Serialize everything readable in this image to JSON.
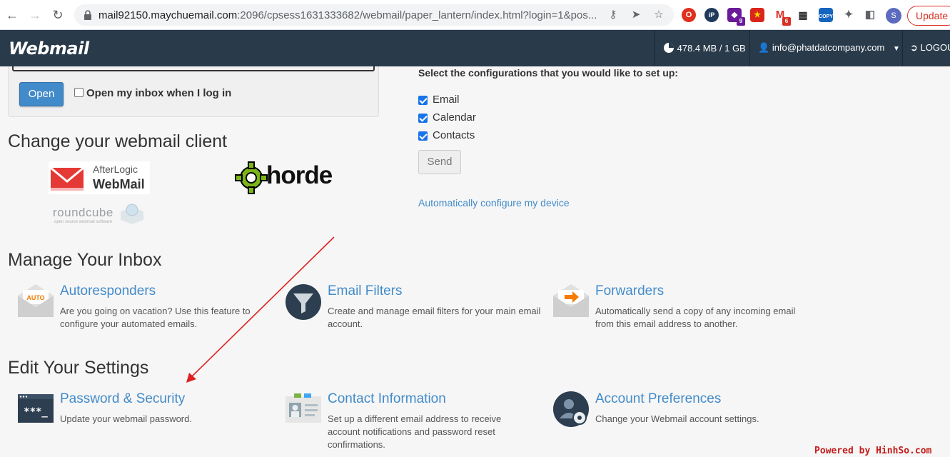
{
  "browser": {
    "url_host": "mail92150.maychuemail.com",
    "url_rest": ":2096/cpsess1631333682/webmail/paper_lantern/index.html?login=1&pos...",
    "update_label": "Update",
    "avatar_letter": "S",
    "ext_badges": {
      "badge1": "9",
      "badge2": "6"
    },
    "copy_label": "COPY"
  },
  "topbar": {
    "logo": "Webmail",
    "disk_usage": "478.4 MB / 1 GB",
    "user_email": "info@phatdatcompany.com",
    "logout": "LOGOUT"
  },
  "open_box": {
    "open_label": "Open",
    "checkbox_label": "Open my inbox when I log in"
  },
  "configure": {
    "heading": "Select the configurations that you would like to set up:",
    "items": [
      {
        "label": "Email",
        "checked": true
      },
      {
        "label": "Calendar",
        "checked": true
      },
      {
        "label": "Contacts",
        "checked": true
      }
    ],
    "send_label": "Send",
    "auto_link": "Automatically configure my device"
  },
  "clients": {
    "heading": "Change your webmail client",
    "afterlogic_line1": "AfterLogic",
    "afterlogic_line2": "WebMail",
    "horde": "horde",
    "roundcube": "roundcube",
    "roundcube_sub": "open source webmail software"
  },
  "inbox": {
    "heading": "Manage Your Inbox",
    "features": [
      {
        "title": "Autoresponders",
        "icon_text": "AUTO",
        "desc": "Are you going on vacation? Use this feature to configure your automated emails."
      },
      {
        "title": "Email Filters",
        "desc": "Create and manage email filters for your main email account."
      },
      {
        "title": "Forwarders",
        "desc": "Automatically send a copy of any incoming email from this email address to another."
      }
    ]
  },
  "settings": {
    "heading": "Edit Your Settings",
    "features": [
      {
        "title": "Password & Security",
        "icon_text": "***_",
        "desc": "Update your webmail password."
      },
      {
        "title": "Contact Information",
        "desc": "Set up a different email address to receive account notifications and password reset confirmations."
      },
      {
        "title": "Account Preferences",
        "desc": "Change your Webmail account settings."
      }
    ]
  },
  "watermark": "Powered by HinhSo.com",
  "colors": {
    "accent": "#428bca",
    "topbar": "#293a4a",
    "annotation_arrow": "#e02020"
  }
}
